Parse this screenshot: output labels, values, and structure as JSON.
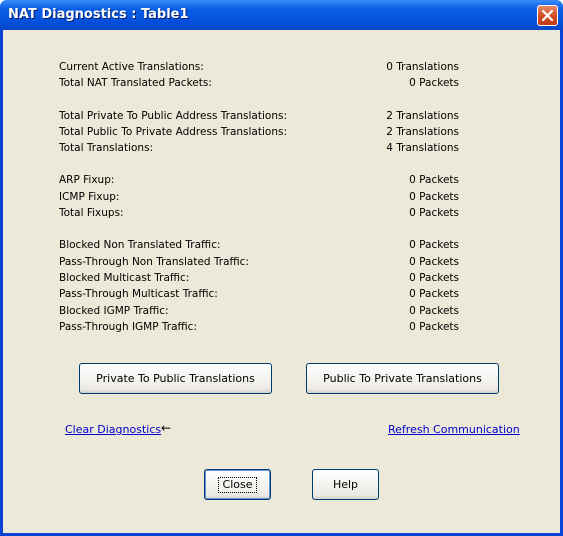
{
  "window": {
    "title": "NAT Diagnostics : Table1",
    "close_icon": "close-icon"
  },
  "stats": {
    "group1": [
      {
        "label": "Current Active Translations:",
        "value": "0 Translations"
      },
      {
        "label": "Total NAT Translated Packets:",
        "value": "0 Packets"
      }
    ],
    "group2": [
      {
        "label": "Total Private To Public Address Translations:",
        "value": "2 Translations"
      },
      {
        "label": "Total Public To Private Address Translations:",
        "value": "2 Translations"
      },
      {
        "label": "Total Translations:",
        "value": "4 Translations"
      }
    ],
    "group3": [
      {
        "label": "ARP Fixup:",
        "value": "0 Packets"
      },
      {
        "label": "ICMP Fixup:",
        "value": "0 Packets"
      },
      {
        "label": "Total Fixups:",
        "value": "0 Packets"
      }
    ],
    "group4": [
      {
        "label": "Blocked Non Translated Traffic:",
        "value": "0 Packets"
      },
      {
        "label": "Pass-Through Non Translated Traffic:",
        "value": "0 Packets"
      },
      {
        "label": "Blocked Multicast Traffic:",
        "value": "0 Packets"
      },
      {
        "label": "Pass-Through Multicast Traffic:",
        "value": "0 Packets"
      },
      {
        "label": "Blocked IGMP Traffic:",
        "value": "0 Packets"
      },
      {
        "label": "Pass-Through IGMP Traffic:",
        "value": "0 Packets"
      }
    ]
  },
  "buttons": {
    "private_to_public": "Private To Public Translations",
    "public_to_private": "Public To Private Translations",
    "close": "Close",
    "help": "Help"
  },
  "links": {
    "clear_diagnostics": "Clear Diagnostics",
    "arrow": "←",
    "refresh_communication": "Refresh Communication"
  },
  "colors": {
    "titlebar": "#0550dc",
    "dialog_bg": "#ece9d8",
    "link": "#0000cc",
    "close_button": "#d04a1f"
  }
}
